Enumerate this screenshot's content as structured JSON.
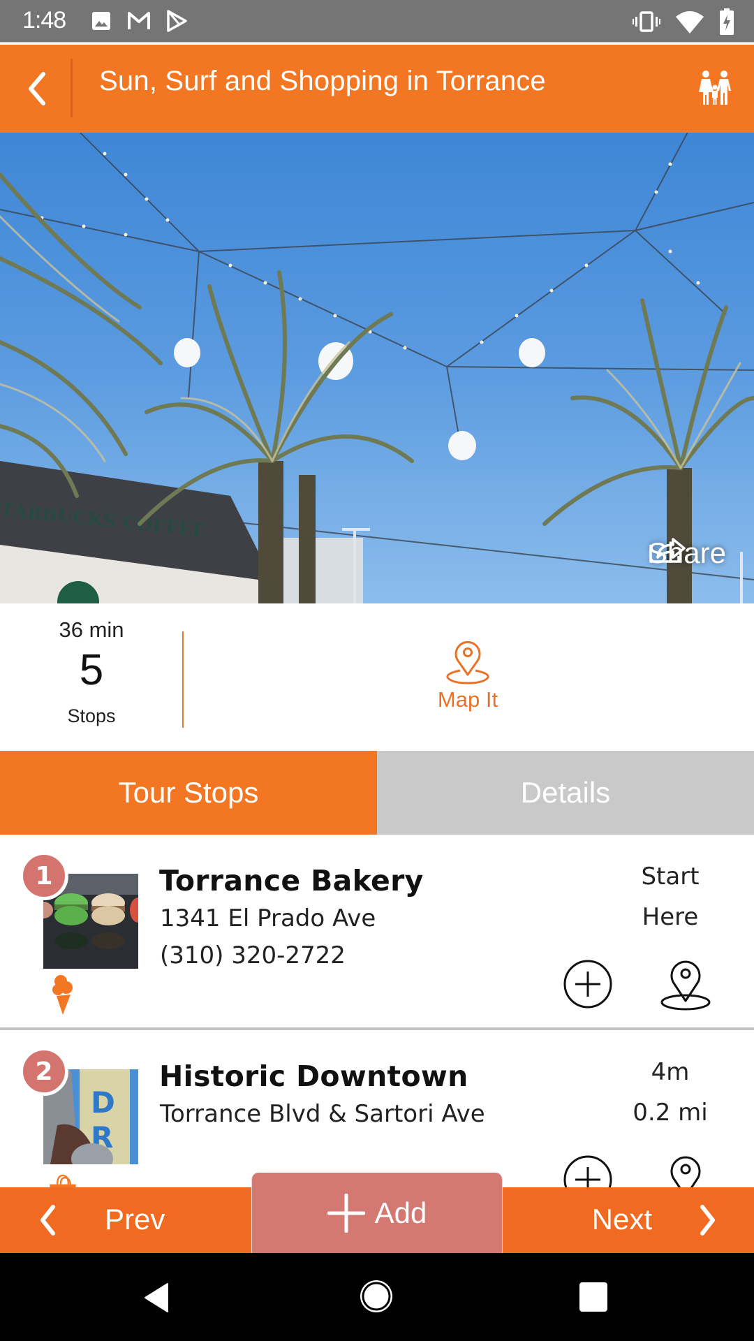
{
  "status_bar": {
    "time": "1:48",
    "left_icons": [
      "image-icon",
      "gmail-icon",
      "play-store-icon"
    ],
    "right_icons": [
      "vibrate-icon",
      "wifi-icon",
      "battery-charging-icon"
    ]
  },
  "header": {
    "title": "Sun, Surf and Shopping in Torrance",
    "back_icon": "chevron-left-icon",
    "right_icon": "family-icon"
  },
  "hero": {
    "share_label": "Share",
    "share_icon": "share-icon",
    "sign_text": "TARBUCKS COFFEE"
  },
  "summary": {
    "duration": "36 min",
    "stop_count": "5",
    "stop_label": "Stops",
    "map_label": "Map It"
  },
  "tabs": [
    {
      "label": "Tour Stops",
      "active": true
    },
    {
      "label": "Details",
      "active": false
    }
  ],
  "stops": [
    {
      "number": "1",
      "name": "Torrance Bakery",
      "address": "1341 El Prado Ave",
      "phone": "(310) 320-2722",
      "meta_line1": "Start",
      "meta_line2": "Here",
      "category_icon": "ice-cream-icon"
    },
    {
      "number": "2",
      "name": "Historic Downtown",
      "address": "Torrance Blvd & Sartori Ave",
      "phone": "",
      "meta_line1": "4m",
      "meta_line2": "0.2 mi",
      "category_icon": "shopping-bag-icon"
    }
  ],
  "action_bar": {
    "prev_label": "Prev",
    "add_label": "Add",
    "next_label": "Next"
  },
  "colors": {
    "brand_orange": "#f37722",
    "action_orange": "#f06a22",
    "badge_red": "#d4746e",
    "tab_inactive": "#c9c9c9",
    "status_bar": "#757575"
  }
}
